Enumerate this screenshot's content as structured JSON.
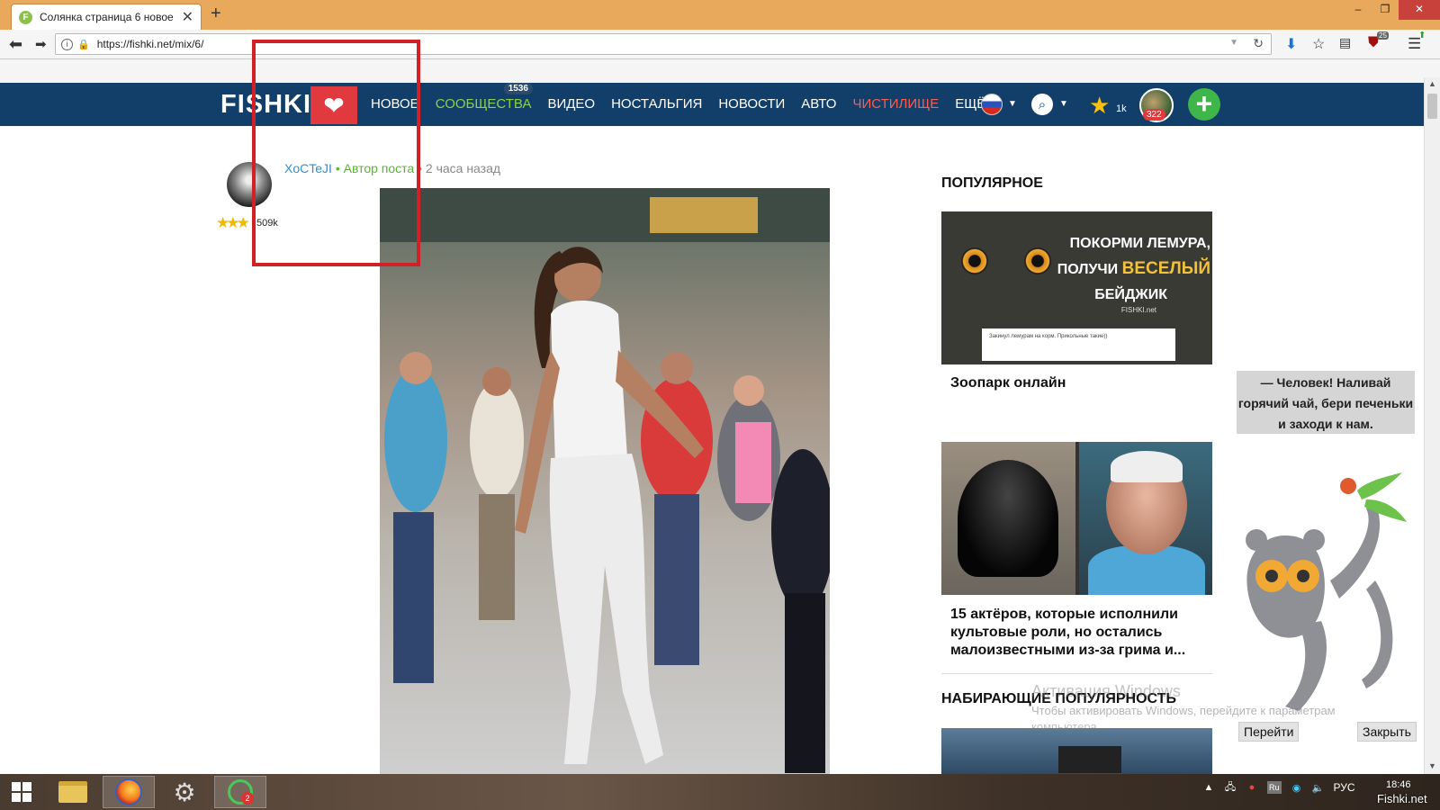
{
  "browser": {
    "tab_title": "Солянка страница 6 новое",
    "tab_favicon": "F",
    "new_tab": "+",
    "url": "https://fishki.net/mix/6/",
    "window_controls": [
      "–",
      "❐",
      "✕"
    ],
    "toolbar_icons": [
      "download-icon",
      "bookmark-star-icon",
      "reading-list-icon",
      "ublock-icon",
      "addon-icon",
      "hamburger-menu-icon"
    ],
    "addon_badge": "25"
  },
  "site": {
    "logo_text": "FISHKI",
    "menu": [
      {
        "label": "Новое",
        "style": "normal"
      },
      {
        "label": "Сообщества",
        "style": "green",
        "badge": "1536"
      },
      {
        "label": "Видео",
        "style": "normal"
      },
      {
        "label": "Ностальгия",
        "style": "normal"
      },
      {
        "label": "Новости",
        "style": "normal"
      },
      {
        "label": "Авто",
        "style": "normal"
      },
      {
        "label": "Чистилище",
        "style": "red"
      },
      {
        "label": "Ещё",
        "style": "normal"
      }
    ],
    "star_count": "1k",
    "user_badge": "322",
    "add_label": "+"
  },
  "post": {
    "author_name": "XoCTeJI",
    "author_role": "Автор поста",
    "separator": "•",
    "time_ago": "2 часа назад",
    "author_rating": "509k",
    "author_stars": "★★★"
  },
  "sidebar": {
    "popular_heading": "Популярное",
    "card1": {
      "promo_line1": "ПОКОРМИ ЛЕМУРА,",
      "promo_line2_a": "ПОЛУЧИ",
      "promo_line2_b": "ВЕСЕЛЫЙ",
      "promo_line3": "БЕЙДЖИК",
      "brand": "FISHKI.net",
      "mini_text": "Закинул лемурам на корм. Прикольные такие))",
      "title": "Зоопарк онлайн"
    },
    "card2": {
      "title": "15 актёров, которые исполнили культовые роли, но остались малоизвестными из-за грима и..."
    },
    "rising_heading": "Набирающие популярность"
  },
  "lemur_widget": {
    "bubble_text": "— Человек! Наливай горячий чай, бери печеньки и заходи к нам.",
    "go_button": "Перейти",
    "close_button": "Закрыть"
  },
  "watermark": {
    "line1": "Активация Windows",
    "line2": "Чтобы активировать Windows, перейдите к параметрам",
    "line3": "компьютера."
  },
  "taskbar": {
    "apps": [
      "start-button",
      "file-explorer",
      "firefox",
      "settings",
      "green-app"
    ],
    "green_app_badge": "2",
    "lang": "РУС",
    "tray_lang_icon": "Ru",
    "time": "18:46",
    "site_watermark": "Fishki.net"
  },
  "colors": {
    "site_header": "#123f69",
    "accent_green": "#8bd14a",
    "accent_red": "#ff5b4e",
    "annotation_box": "#d32026",
    "tab_strip": "#e8a95c"
  }
}
